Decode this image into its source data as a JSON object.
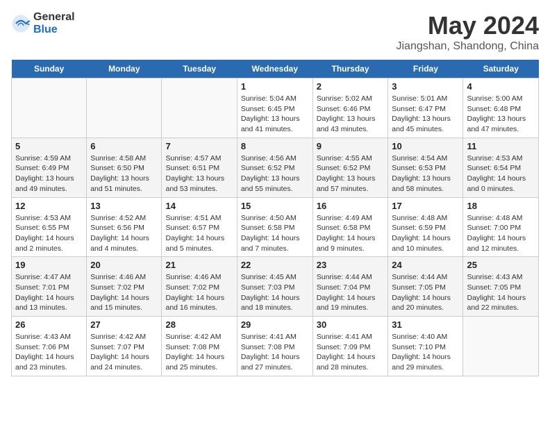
{
  "header": {
    "logo_general": "General",
    "logo_blue": "Blue",
    "title": "May 2024",
    "subtitle": "Jiangshan, Shandong, China"
  },
  "days_of_week": [
    "Sunday",
    "Monday",
    "Tuesday",
    "Wednesday",
    "Thursday",
    "Friday",
    "Saturday"
  ],
  "weeks": [
    [
      {
        "date": "",
        "info": ""
      },
      {
        "date": "",
        "info": ""
      },
      {
        "date": "",
        "info": ""
      },
      {
        "date": "1",
        "info": "Sunrise: 5:04 AM\nSunset: 6:45 PM\nDaylight: 13 hours and 41 minutes."
      },
      {
        "date": "2",
        "info": "Sunrise: 5:02 AM\nSunset: 6:46 PM\nDaylight: 13 hours and 43 minutes."
      },
      {
        "date": "3",
        "info": "Sunrise: 5:01 AM\nSunset: 6:47 PM\nDaylight: 13 hours and 45 minutes."
      },
      {
        "date": "4",
        "info": "Sunrise: 5:00 AM\nSunset: 6:48 PM\nDaylight: 13 hours and 47 minutes."
      }
    ],
    [
      {
        "date": "5",
        "info": "Sunrise: 4:59 AM\nSunset: 6:49 PM\nDaylight: 13 hours and 49 minutes."
      },
      {
        "date": "6",
        "info": "Sunrise: 4:58 AM\nSunset: 6:50 PM\nDaylight: 13 hours and 51 minutes."
      },
      {
        "date": "7",
        "info": "Sunrise: 4:57 AM\nSunset: 6:51 PM\nDaylight: 13 hours and 53 minutes."
      },
      {
        "date": "8",
        "info": "Sunrise: 4:56 AM\nSunset: 6:52 PM\nDaylight: 13 hours and 55 minutes."
      },
      {
        "date": "9",
        "info": "Sunrise: 4:55 AM\nSunset: 6:52 PM\nDaylight: 13 hours and 57 minutes."
      },
      {
        "date": "10",
        "info": "Sunrise: 4:54 AM\nSunset: 6:53 PM\nDaylight: 13 hours and 58 minutes."
      },
      {
        "date": "11",
        "info": "Sunrise: 4:53 AM\nSunset: 6:54 PM\nDaylight: 14 hours and 0 minutes."
      }
    ],
    [
      {
        "date": "12",
        "info": "Sunrise: 4:53 AM\nSunset: 6:55 PM\nDaylight: 14 hours and 2 minutes."
      },
      {
        "date": "13",
        "info": "Sunrise: 4:52 AM\nSunset: 6:56 PM\nDaylight: 14 hours and 4 minutes."
      },
      {
        "date": "14",
        "info": "Sunrise: 4:51 AM\nSunset: 6:57 PM\nDaylight: 14 hours and 5 minutes."
      },
      {
        "date": "15",
        "info": "Sunrise: 4:50 AM\nSunset: 6:58 PM\nDaylight: 14 hours and 7 minutes."
      },
      {
        "date": "16",
        "info": "Sunrise: 4:49 AM\nSunset: 6:58 PM\nDaylight: 14 hours and 9 minutes."
      },
      {
        "date": "17",
        "info": "Sunrise: 4:48 AM\nSunset: 6:59 PM\nDaylight: 14 hours and 10 minutes."
      },
      {
        "date": "18",
        "info": "Sunrise: 4:48 AM\nSunset: 7:00 PM\nDaylight: 14 hours and 12 minutes."
      }
    ],
    [
      {
        "date": "19",
        "info": "Sunrise: 4:47 AM\nSunset: 7:01 PM\nDaylight: 14 hours and 13 minutes."
      },
      {
        "date": "20",
        "info": "Sunrise: 4:46 AM\nSunset: 7:02 PM\nDaylight: 14 hours and 15 minutes."
      },
      {
        "date": "21",
        "info": "Sunrise: 4:46 AM\nSunset: 7:02 PM\nDaylight: 14 hours and 16 minutes."
      },
      {
        "date": "22",
        "info": "Sunrise: 4:45 AM\nSunset: 7:03 PM\nDaylight: 14 hours and 18 minutes."
      },
      {
        "date": "23",
        "info": "Sunrise: 4:44 AM\nSunset: 7:04 PM\nDaylight: 14 hours and 19 minutes."
      },
      {
        "date": "24",
        "info": "Sunrise: 4:44 AM\nSunset: 7:05 PM\nDaylight: 14 hours and 20 minutes."
      },
      {
        "date": "25",
        "info": "Sunrise: 4:43 AM\nSunset: 7:05 PM\nDaylight: 14 hours and 22 minutes."
      }
    ],
    [
      {
        "date": "26",
        "info": "Sunrise: 4:43 AM\nSunset: 7:06 PM\nDaylight: 14 hours and 23 minutes."
      },
      {
        "date": "27",
        "info": "Sunrise: 4:42 AM\nSunset: 7:07 PM\nDaylight: 14 hours and 24 minutes."
      },
      {
        "date": "28",
        "info": "Sunrise: 4:42 AM\nSunset: 7:08 PM\nDaylight: 14 hours and 25 minutes."
      },
      {
        "date": "29",
        "info": "Sunrise: 4:41 AM\nSunset: 7:08 PM\nDaylight: 14 hours and 27 minutes."
      },
      {
        "date": "30",
        "info": "Sunrise: 4:41 AM\nSunset: 7:09 PM\nDaylight: 14 hours and 28 minutes."
      },
      {
        "date": "31",
        "info": "Sunrise: 4:40 AM\nSunset: 7:10 PM\nDaylight: 14 hours and 29 minutes."
      },
      {
        "date": "",
        "info": ""
      }
    ]
  ]
}
